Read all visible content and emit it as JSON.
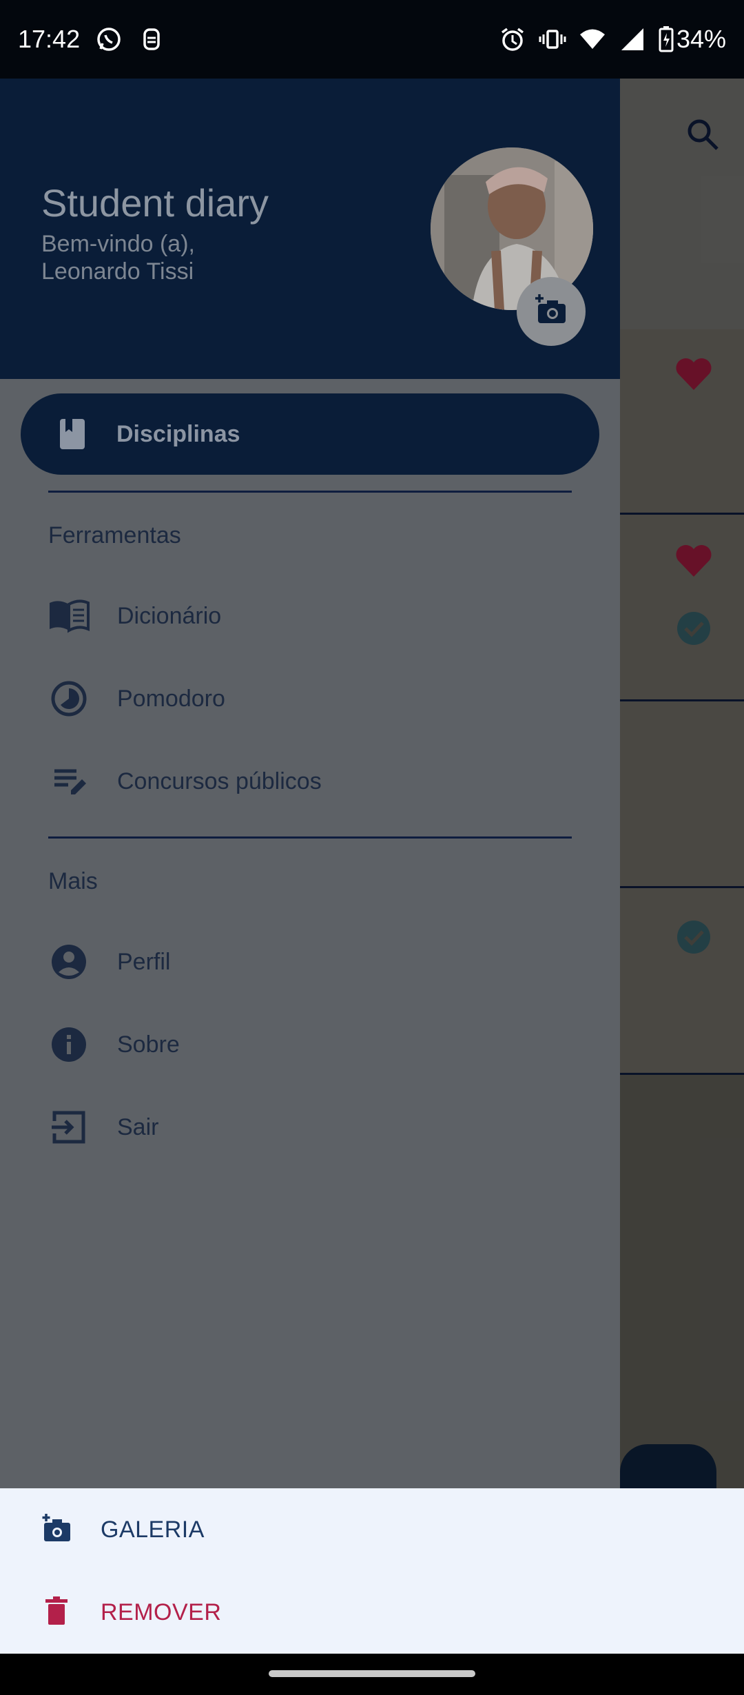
{
  "status_bar": {
    "time": "17:42",
    "battery": "34%"
  },
  "drawer": {
    "app_title": "Student diary",
    "welcome_line1": "Bem-vindo (a),",
    "welcome_line2": "Leonardo Tissi",
    "selected_item": {
      "label": "Disciplinas",
      "icon": "book-icon"
    },
    "sections": [
      {
        "title": "Ferramentas",
        "items": [
          {
            "label": "Dicionário",
            "icon": "dictionary-icon"
          },
          {
            "label": "Pomodoro",
            "icon": "timer-icon"
          },
          {
            "label": "Concursos públicos",
            "icon": "edit-list-icon"
          }
        ]
      },
      {
        "title": "Mais",
        "items": [
          {
            "label": "Perfil",
            "icon": "account-icon"
          },
          {
            "label": "Sobre",
            "icon": "info-icon"
          },
          {
            "label": "Sair",
            "icon": "exit-icon"
          }
        ]
      }
    ]
  },
  "bottom_sheet": {
    "gallery_label": "GALERIA",
    "remove_label": "REMOVER"
  },
  "colors": {
    "accent_dark": "#0a1d38",
    "remove_red": "#b3204a",
    "gallery_blue": "#1c3a66"
  }
}
